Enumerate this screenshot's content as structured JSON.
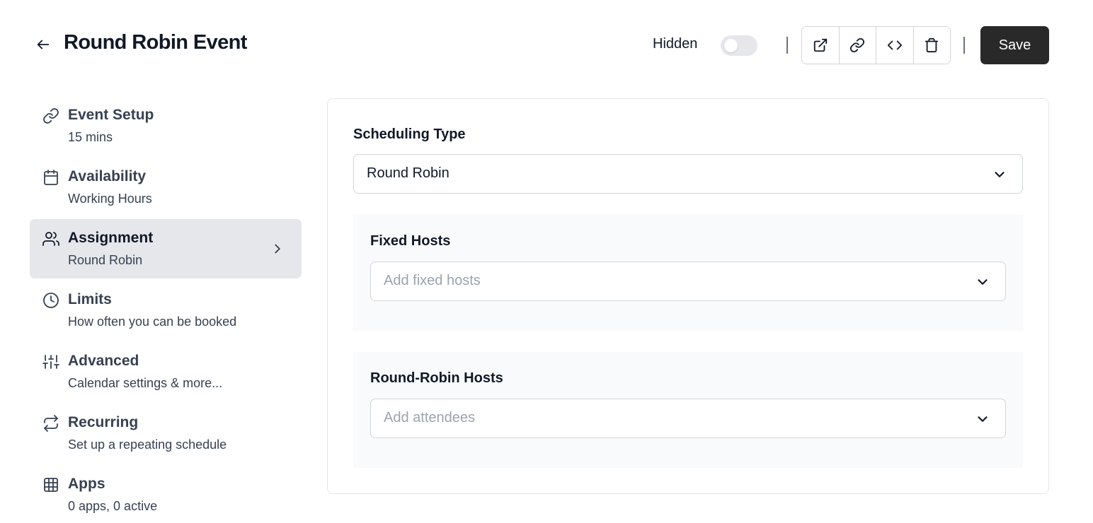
{
  "header": {
    "title": "Round Robin Event",
    "hidden_label": "Hidden",
    "save_label": "Save",
    "hidden_toggle_on": false
  },
  "sidebar": {
    "items": [
      {
        "title": "Event Setup",
        "subtitle": "15 mins",
        "icon": "link-icon"
      },
      {
        "title": "Availability",
        "subtitle": "Working Hours",
        "icon": "calendar-icon"
      },
      {
        "title": "Assignment",
        "subtitle": "Round Robin",
        "icon": "users-icon",
        "active": true
      },
      {
        "title": "Limits",
        "subtitle": "How often you can be booked",
        "icon": "clock-icon"
      },
      {
        "title": "Advanced",
        "subtitle": "Calendar settings & more...",
        "icon": "sliders-icon"
      },
      {
        "title": "Recurring",
        "subtitle": "Set up a repeating schedule",
        "icon": "repeat-icon"
      },
      {
        "title": "Apps",
        "subtitle": "0 apps, 0 active",
        "icon": "grid-icon"
      }
    ]
  },
  "main": {
    "scheduling_type": {
      "label": "Scheduling Type",
      "value": "Round Robin"
    },
    "fixed_hosts": {
      "label": "Fixed Hosts",
      "placeholder": "Add fixed hosts"
    },
    "round_robin_hosts": {
      "label": "Round-Robin Hosts",
      "placeholder": "Add attendees"
    }
  },
  "colors": {
    "save_button_bg": "#292929",
    "active_item_bg": "#e5e7eb",
    "section_bg": "#f9fafb"
  }
}
